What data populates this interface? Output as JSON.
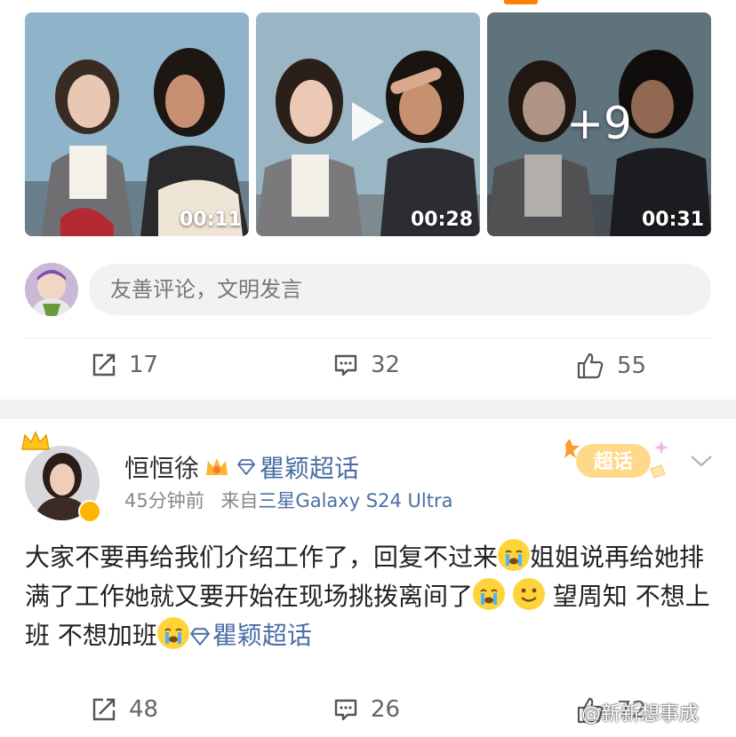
{
  "thumbnails": [
    {
      "duration": "00:11",
      "has_play": false,
      "more": ""
    },
    {
      "duration": "00:28",
      "has_play": true,
      "more": ""
    },
    {
      "duration": "00:31",
      "has_play": false,
      "more": "+9"
    }
  ],
  "comment_input": {
    "placeholder": "友善评论，文明发言"
  },
  "post1_actions": {
    "repost": "17",
    "comment": "32",
    "like": "55"
  },
  "post2": {
    "username": "恒恒徐",
    "topic": "瞿颖超话",
    "time": "45分钟前",
    "source_prefix": "来自",
    "device": "三星Galaxy S24 Ultra",
    "super_badge": "超话",
    "text_1": "大家不要再给我们介绍工作了，回复不过来",
    "text_2": "姐姐说再给她排满了工作她就又要开始在现场挑拨离间了",
    "text_3": " 望周知 不想上班 不想加班",
    "topic_inline": "瞿颖超话",
    "actions": {
      "repost": "48",
      "comment": "26",
      "like": "72"
    }
  },
  "watermark": "@新新想事成",
  "colors": {
    "accent": "#ff8200",
    "link": "#4a6fa5",
    "band": "#f1f1f1"
  }
}
